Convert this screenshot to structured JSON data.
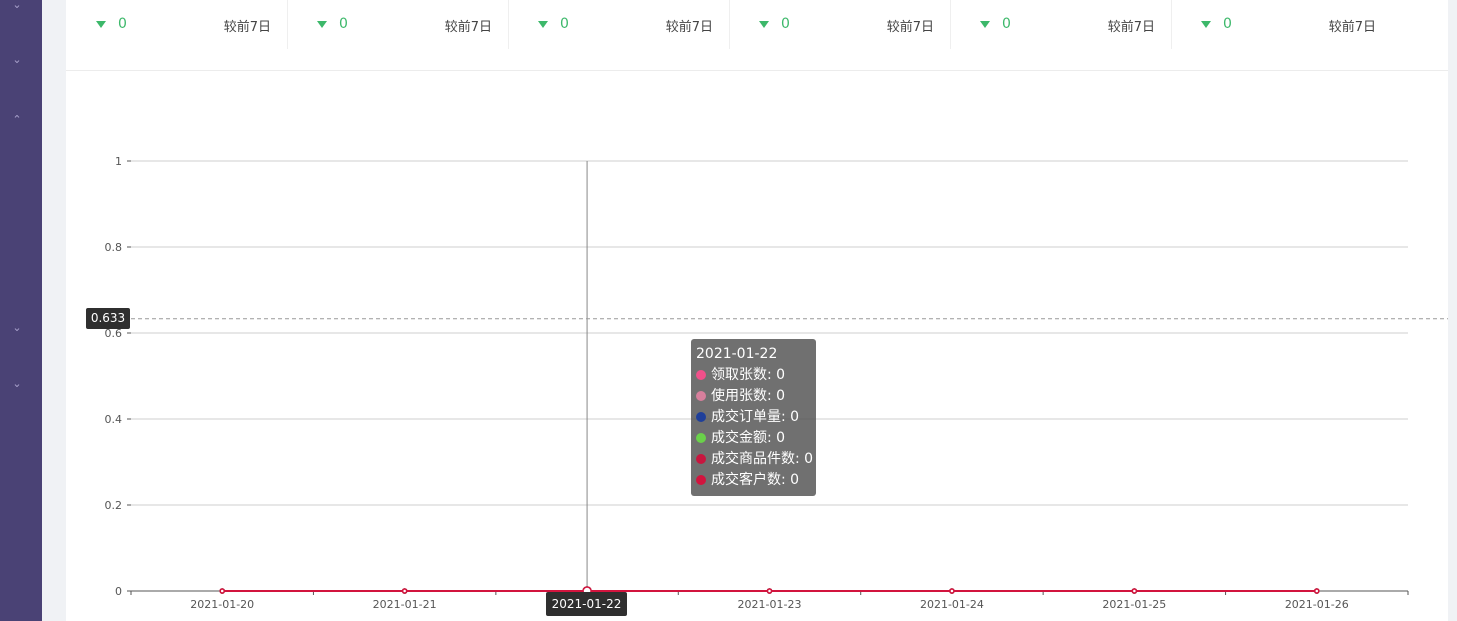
{
  "sidebar": {
    "icons": [
      "chevron-down-icon",
      "chevron-down-icon",
      "chevron-up-icon",
      "chevron-down-icon",
      "chevron-down-icon"
    ],
    "color": "#4a4275"
  },
  "stats": [
    {
      "value": "0",
      "compare": "较前7日"
    },
    {
      "value": "0",
      "compare": "较前7日"
    },
    {
      "value": "0",
      "compare": "较前7日"
    },
    {
      "value": "0",
      "compare": "较前7日"
    },
    {
      "value": "0",
      "compare": "较前7日"
    },
    {
      "value": "0",
      "compare": "较前7日"
    }
  ],
  "chart_data": {
    "type": "line",
    "x": [
      "2021-01-20",
      "2021-01-21",
      "2021-01-22",
      "2021-01-23",
      "2021-01-24",
      "2021-01-25",
      "2021-01-26"
    ],
    "yticks": [
      "0",
      "0.2",
      "0.4",
      "0.6",
      "0.8",
      "1"
    ],
    "ylim": [
      0,
      1
    ],
    "grid": true,
    "series": [
      {
        "name": "领取张数",
        "color": "#f0508a",
        "values": [
          0,
          0,
          0,
          0,
          0,
          0,
          0
        ]
      },
      {
        "name": "使用张数",
        "color": "#d77f9c",
        "values": [
          0,
          0,
          0,
          0,
          0,
          0,
          0
        ]
      },
      {
        "name": "成交订单量",
        "color": "#1f3f9a",
        "values": [
          0,
          0,
          0,
          0,
          0,
          0,
          0
        ]
      },
      {
        "name": "成交金额",
        "color": "#6ad14a",
        "values": [
          0,
          0,
          0,
          0,
          0,
          0,
          0
        ]
      },
      {
        "name": "成交商品件数",
        "color": "#c8163f",
        "values": [
          0,
          0,
          0,
          0,
          0,
          0,
          0
        ]
      },
      {
        "name": "成交客户数",
        "color": "#d2143e",
        "values": [
          0,
          0,
          0,
          0,
          0,
          0,
          0
        ]
      }
    ]
  },
  "tooltip": {
    "date": "2021-01-22",
    "rows": [
      {
        "label": "领取张数: 0",
        "color": "#f0508a"
      },
      {
        "label": "使用张数: 0",
        "color": "#d77f9c"
      },
      {
        "label": "成交订单量: 0",
        "color": "#1f3f9a"
      },
      {
        "label": "成交金额: 0",
        "color": "#6ad14a"
      },
      {
        "label": "成交商品件数: 0",
        "color": "#c8163f"
      },
      {
        "label": "成交客户数: 0",
        "color": "#d2143e"
      }
    ]
  },
  "crosshair": {
    "y_value": "0.633",
    "x_value": "2021-01-22"
  }
}
